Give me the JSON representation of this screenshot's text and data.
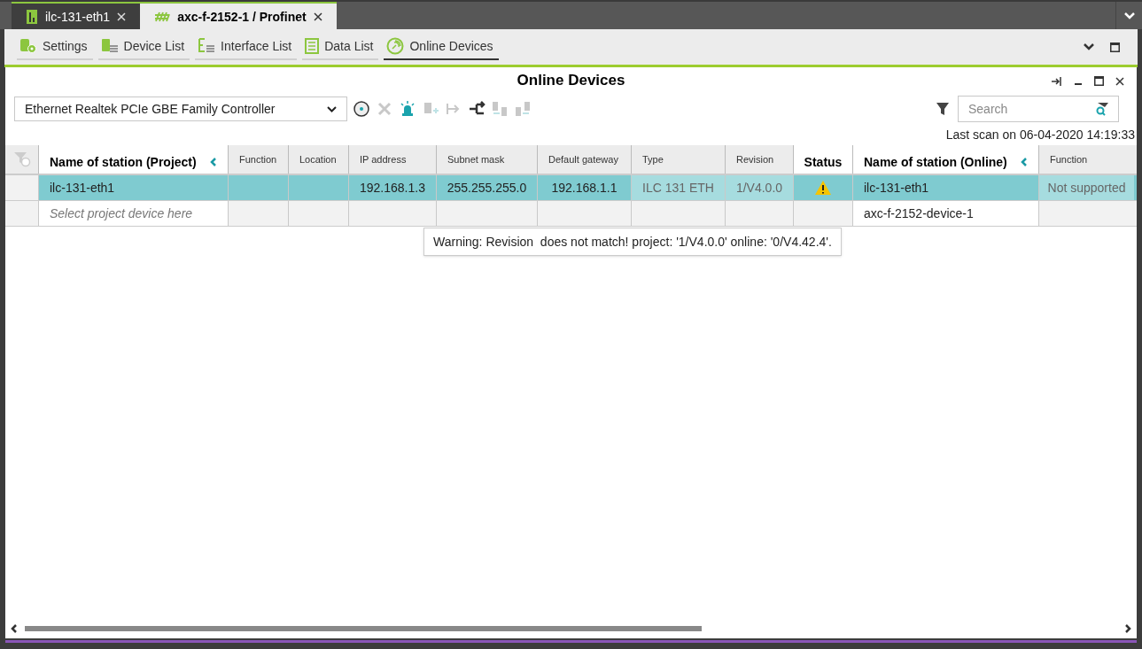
{
  "editor_tabs": [
    {
      "label": "ilc-131-eth1",
      "selected": false,
      "kind": "device"
    },
    {
      "label": "axc-f-2152-1 / Profinet",
      "selected": true,
      "kind": "network"
    }
  ],
  "view_tabs": [
    {
      "label": "Settings",
      "selected": false,
      "kind": "settings"
    },
    {
      "label": "Device List",
      "selected": false,
      "kind": "devices"
    },
    {
      "label": "Interface List",
      "selected": false,
      "kind": "interfaces"
    },
    {
      "label": "Data List",
      "selected": false,
      "kind": "data"
    },
    {
      "label": "Online Devices",
      "selected": true,
      "kind": "online"
    }
  ],
  "panel": {
    "title": "Online Devices",
    "adapter": "Ethernet Realtek PCIe GBE Family Controller",
    "toolbar": [
      {
        "kind": "scan",
        "disabled": false
      },
      {
        "kind": "clear",
        "disabled": true
      },
      {
        "kind": "flash",
        "disabled": false
      },
      {
        "kind": "add",
        "disabled": true
      },
      {
        "kind": "assign",
        "disabled": true
      },
      {
        "kind": "swap",
        "disabled": false
      },
      {
        "kind": "write",
        "disabled": true
      },
      {
        "kind": "read",
        "disabled": true
      }
    ],
    "search": {
      "placeholder": "Search"
    },
    "last_scan": "Last scan on 06-04-2020 14:19:33",
    "columns": [
      {
        "label": "Name of station (Project)",
        "kind": "main",
        "readonly": false
      },
      {
        "label": "Function",
        "kind": "plain",
        "readonly": false
      },
      {
        "label": "Location",
        "kind": "plain",
        "readonly": false
      },
      {
        "label": "IP address",
        "kind": "plain",
        "readonly": false
      },
      {
        "label": "Subnet mask",
        "kind": "plain",
        "readonly": false
      },
      {
        "label": "Default gateway",
        "kind": "plain",
        "readonly": false
      },
      {
        "label": "Type",
        "kind": "plain",
        "readonly": true
      },
      {
        "label": "Revision",
        "kind": "plain",
        "readonly": true
      },
      {
        "label": "Status",
        "kind": "status",
        "readonly": false
      },
      {
        "label": "Name of station (Online)",
        "kind": "main",
        "readonly": false
      },
      {
        "label": "Function",
        "kind": "plain",
        "readonly": true
      }
    ],
    "rows": [
      {
        "selected": true,
        "cells": [
          "ilc-131-eth1",
          null,
          null,
          "192.168.1.3",
          "255.255.255.0",
          "192.168.1.1",
          "ILC 131 ETH",
          "1/V4.0.0",
          {
            "kind": "warning"
          },
          "ilc-131-eth1",
          "Not supported"
        ]
      },
      {
        "selected": false,
        "placeholder": "Select project device here",
        "cells": [
          null,
          null,
          null,
          null,
          null,
          null,
          null,
          null,
          null,
          "axc-f-2152-device-1",
          null
        ]
      }
    ],
    "tooltip": "Warning: Revision  does not match! project: '1/V4.0.0' online: '0/V4.42.4'."
  }
}
